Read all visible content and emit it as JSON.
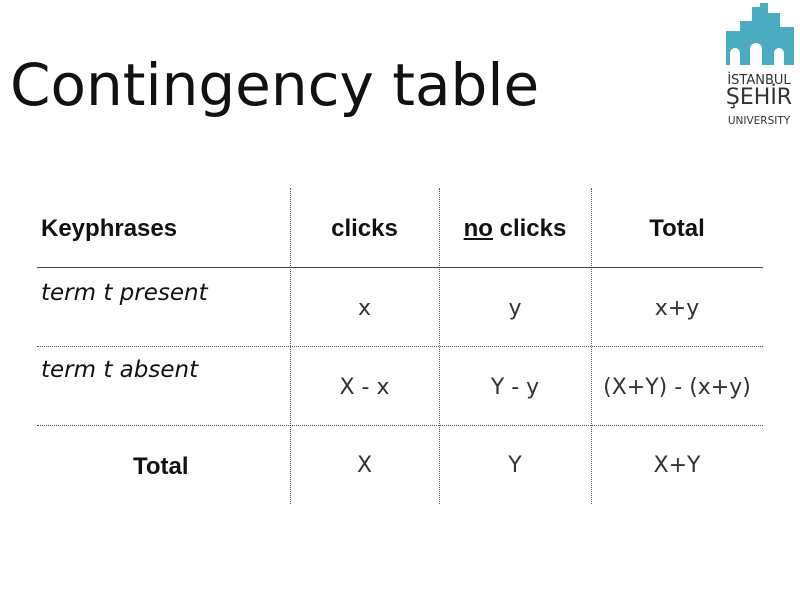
{
  "slide": {
    "title": "Contingency table"
  },
  "logo": {
    "line1": "İSTANBUL",
    "line2": "ŞEHİR",
    "line3": "UNIVERSITY",
    "color": "#4aabc1"
  },
  "table": {
    "headers": {
      "keyphrases": "Keyphrases",
      "clicks": "clicks",
      "no_clicks_prefix": "no",
      "no_clicks_suffix": " clicks",
      "total": "Total"
    },
    "rows": [
      {
        "label_pre": "term ",
        "label_var": "t",
        "label_post": " present",
        "clicks": "x",
        "no_clicks": "y",
        "total": "x+y"
      },
      {
        "label_pre": "term ",
        "label_var": "t",
        "label_post": " absent",
        "clicks": "X - x",
        "no_clicks": "Y - y",
        "total": "(X+Y) - (x+y)"
      },
      {
        "label": "Total",
        "clicks": "X",
        "no_clicks": "Y",
        "total": "X+Y"
      }
    ]
  }
}
